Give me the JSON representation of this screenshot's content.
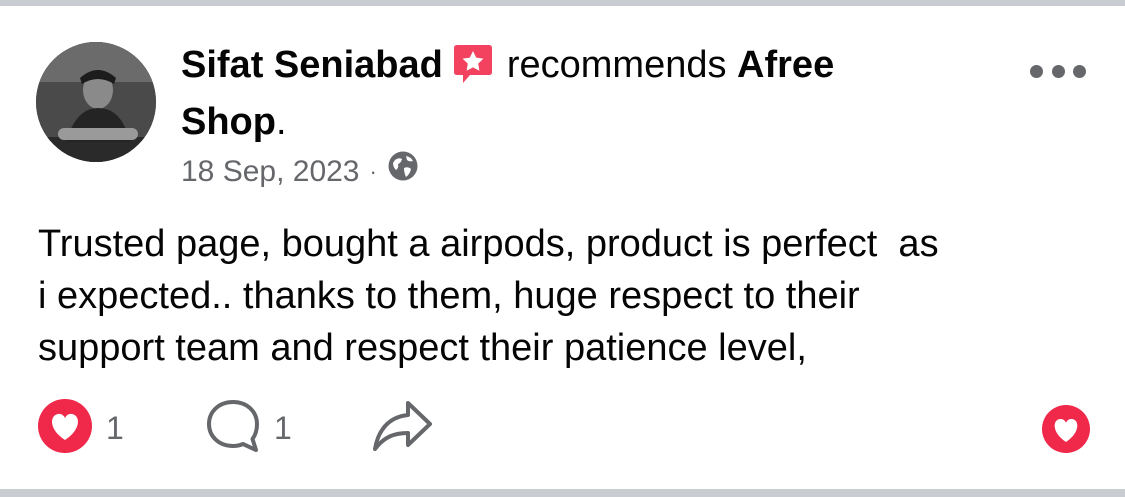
{
  "post": {
    "author": "Sifat Seniabad",
    "action_text": "recommends",
    "page_name_line1": "Afree",
    "page_name_line2": "Shop",
    "period": ".",
    "date": "18 Sep, 2023",
    "separator": "·",
    "privacy_icon": "globe-icon",
    "badge_icon": "recommend-star-badge-icon",
    "body_lines": [
      "Trusted page, bought a airpods, product is perfect  as",
      "i expected.. thanks to them, huge respect to their",
      "support team and respect their patience level,"
    ]
  },
  "actions": {
    "like_count": "1",
    "comment_count": "1",
    "like_icon": "heart-icon",
    "comment_icon": "comment-bubble-icon",
    "share_icon": "share-arrow-icon"
  },
  "colors": {
    "heart": "#f0284a",
    "badge": "#f3425f",
    "secondary_text": "#65676b",
    "border": "#c9ccd1"
  }
}
